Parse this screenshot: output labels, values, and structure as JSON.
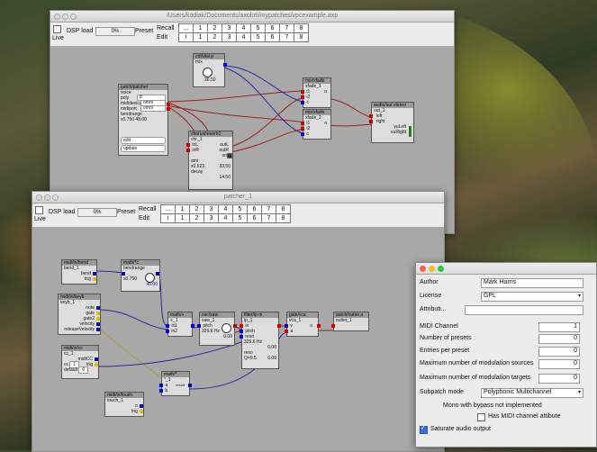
{
  "main_window": {
    "title": "/Users/kodiak/Documents/axoloti/mypatches/vpcexample.axp",
    "live_label": "Live",
    "dsp_label": "DSP load",
    "dsp_value": "0%",
    "preset_label": "Preset",
    "recall_label": "Recall",
    "edit_label": "Edit",
    "recall_cells": [
      "...",
      "1",
      "2",
      "3",
      "4",
      "5",
      "6",
      "7",
      "8"
    ],
    "edit_cells": [
      "i",
      "1",
      "2",
      "3",
      "4",
      "5",
      "6",
      "7",
      "8"
    ]
  },
  "main_objects": {
    "ctrl": {
      "header": "ctrl/dial p",
      "name": "mix",
      "value": "26.50"
    },
    "patcher": {
      "header": "patch/patcher",
      "name": "voice",
      "poly_label": "poly",
      "poly_value": "8",
      "mididevice_label": "mididevice",
      "mididevice_value": "omni",
      "midiport_label": "midiport",
      "midiport_value": "omni",
      "bendrange_label": "bendrange",
      "bendrange_value": "48.00",
      "x_value": "x0.750",
      "edit_label": "edit",
      "update_label": "update"
    },
    "reverb": {
      "header": "chorus/reverb1",
      "name": "chr_1",
      "inL": "inL",
      "inR": "inR",
      "outL": "outL",
      "outR": "outR",
      "on": "on",
      "amt_label": "amt",
      "amt_x": "x0.523",
      "amt_value": "33.50",
      "decay_label": "decay",
      "decay_value": "14.50"
    },
    "xfade1": {
      "header": "mix/xfade",
      "name": "xfade_1",
      "i1": "i1",
      "i2": "i2",
      "c": "c",
      "o": "o"
    },
    "xfade2": {
      "header": "mix/xfade",
      "name": "xfade_2",
      "i1": "i1",
      "i2": "i2",
      "c": "c",
      "o": "o"
    },
    "audioout": {
      "header": "audio/out stereo",
      "name": "out_1",
      "left": "left",
      "right": "right",
      "vuleft": "vuLeft",
      "vuright": "vuRight"
    }
  },
  "sub_window": {
    "title": "patcher_1",
    "live_label": "Live",
    "dsp_label": "DSP load",
    "dsp_value": "0%",
    "preset_label": "Preset",
    "recall_label": "Recall",
    "edit_label": "Edit",
    "recall_cells": [
      "...",
      "1",
      "2",
      "3",
      "4",
      "5",
      "6",
      "7",
      "8"
    ],
    "edit_cells": [
      "i",
      "1",
      "2",
      "3",
      "4",
      "5",
      "6",
      "7",
      "8"
    ]
  },
  "sub_objects": {
    "bend": {
      "header": "midi/in/bend",
      "name": "bend_1",
      "bend": "bend",
      "trig": "trig"
    },
    "mathc": {
      "header": "math/*c",
      "name": "bendrange",
      "x": "x0.750",
      "value": "48.00"
    },
    "keyb": {
      "header": "midi/in/keyb",
      "name": "keyb_1",
      "note": "note",
      "gate": "gate",
      "gate2": "gate2",
      "velocity": "velocity",
      "release": "releaseVelocity"
    },
    "cc": {
      "header": "midi/in/cc",
      "name": "cc_1",
      "midicc": "midiCC",
      "trig": "trig",
      "cc_label": "cc",
      "cc_value": "1",
      "default_label": "default",
      "default_value": "0"
    },
    "touch": {
      "header": "midi/in/touch",
      "name": "touch_1",
      "o": "o",
      "trig": "trig"
    },
    "plus": {
      "header": "math/+",
      "name": "+_1",
      "in1": "in1",
      "in2": "in2",
      "out": "out"
    },
    "saw": {
      "header": "osc/saw",
      "name": "saw_1",
      "pitch": "pitch",
      "freq": "329.6 Hz",
      "value": "0.00"
    },
    "lp": {
      "header": "filter/lp m",
      "name": "lp_1",
      "in": "in",
      "pitch": "pitch",
      "reso": "reso",
      "freq": "329.6 Hz",
      "pval": "0.00",
      "reso_label": "reso",
      "q": "Q=0.5",
      "rval": "0.00"
    },
    "vca": {
      "header": "gain/vca",
      "name": "vca_1",
      "v": "v",
      "a": "a",
      "o": "o"
    },
    "times": {
      "header": "math/*",
      "name": "*_1",
      "a": "a",
      "b": "b",
      "r": "result"
    },
    "outlet": {
      "header": "patch/outlet a",
      "name": "outlet_1"
    }
  },
  "settings_panel": {
    "author_label": "Author",
    "author_value": "Mark Harris",
    "license_label": "License",
    "license_value": "GPL",
    "attribution_label": "Attributi...",
    "midi_channel_label": "MIDI Channel",
    "midi_channel_value": "1",
    "num_presets_label": "Number of presets",
    "num_presets_value": "0",
    "entries_per_preset_label": "Entries per preset",
    "entries_per_preset_value": "0",
    "max_mod_sources_label": "Maximum number of modulation sources",
    "max_mod_sources_value": "0",
    "max_mod_targets_label": "Maximum number of modulation targets",
    "max_mod_targets_value": "0",
    "subpatch_mode_label": "Subpatch mode",
    "subpatch_mode_value": "Polyphonic Multichannel",
    "mono_bypass_note": "Mono with bypass not implemented",
    "midi_channel_attr_label": "Has MIDI channel attibute",
    "saturate_label": "Saturate audio output"
  },
  "colors": {
    "red_pin": "#cc0000",
    "blue_pin": "#0000cc",
    "yellow_pin": "#d8c000",
    "wire_red": "#9a2020",
    "wire_blue": "#2a2a9a"
  }
}
